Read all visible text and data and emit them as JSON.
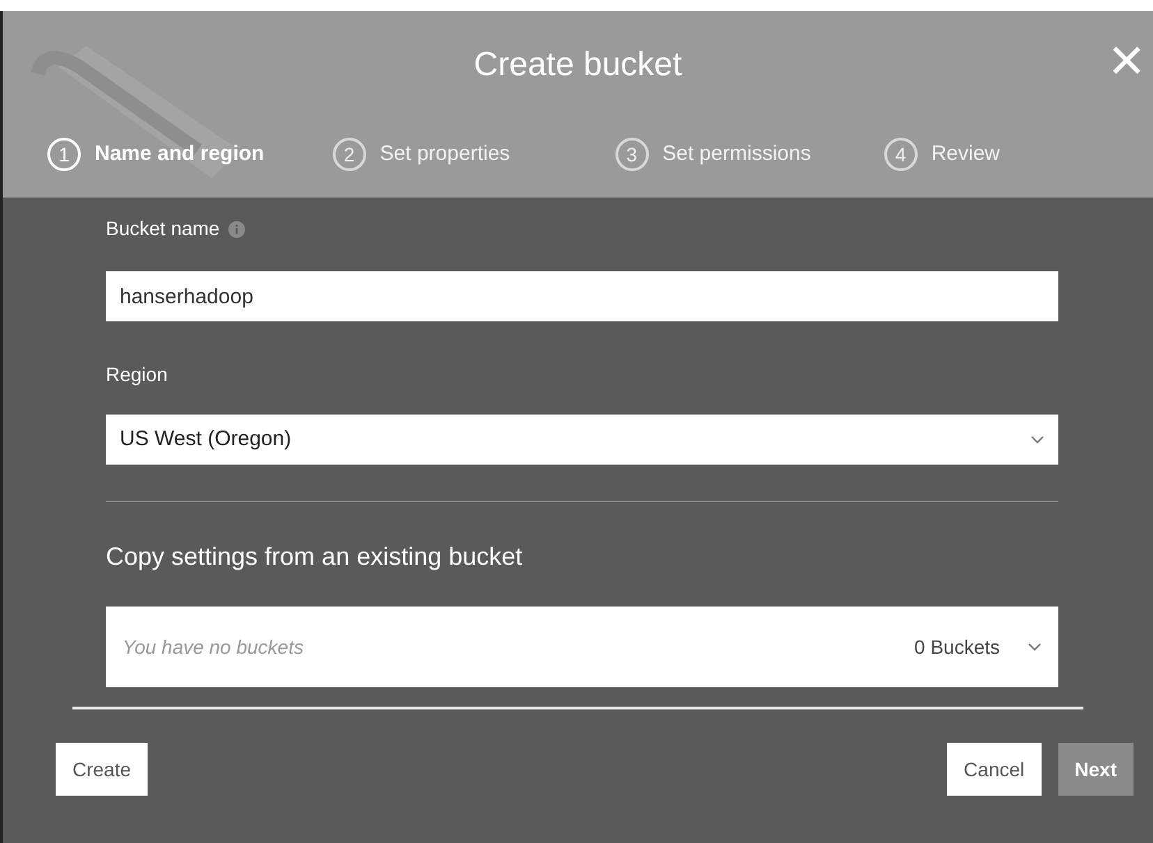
{
  "dialog": {
    "title": "Create bucket",
    "close": "×"
  },
  "steps": [
    {
      "number": "1",
      "label": "Name and region",
      "selected": true
    },
    {
      "number": "2",
      "label": "Set properties",
      "selected": false
    },
    {
      "number": "3",
      "label": "Set permissions",
      "selected": false
    },
    {
      "number": "4",
      "label": "Review",
      "selected": false
    }
  ],
  "bucket_name": {
    "label": "Bucket name",
    "value": "hanserhadoop"
  },
  "region": {
    "label": "Region",
    "value": "US West (Oregon)"
  },
  "copy_settings": {
    "heading": "Copy settings from an existing bucket",
    "placeholder": "You have no buckets",
    "count": "0 Buckets"
  },
  "buttons": {
    "create": "Create",
    "cancel": "Cancel",
    "next": "Next"
  }
}
